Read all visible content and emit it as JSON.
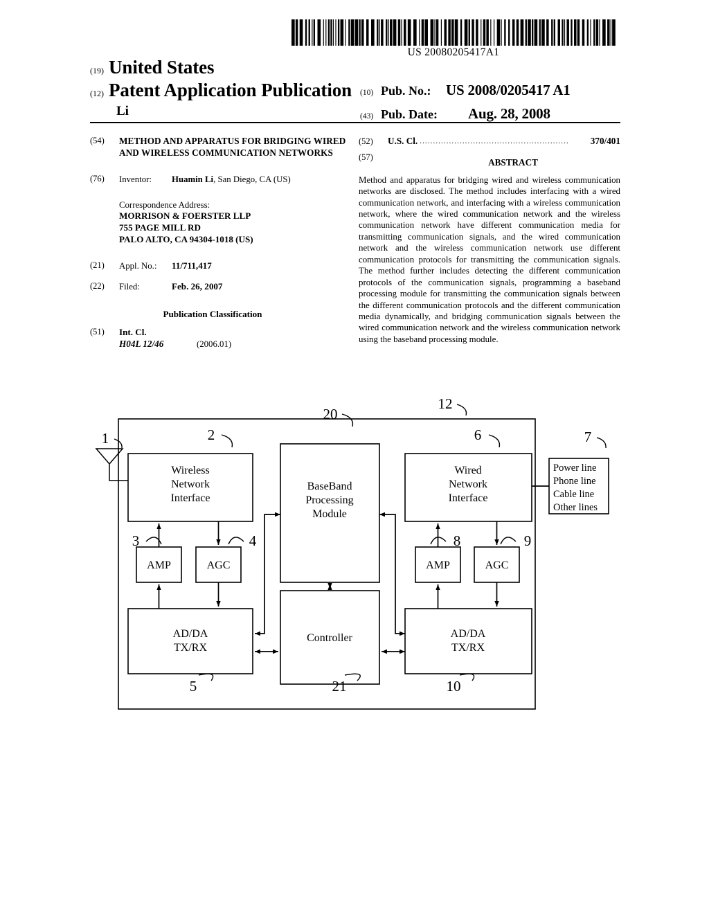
{
  "barcode": {
    "number": "US 20080205417A1"
  },
  "masthead": {
    "code_19": "(19)",
    "country": "United States",
    "code_12": "(12)",
    "doc_type": "Patent Application Publication",
    "author": "Li",
    "pub_no_code": "(10)",
    "pub_no_label": "Pub. No.:",
    "pub_no_value": "US 2008/0205417 A1",
    "pub_date_code": "(43)",
    "pub_date_label": "Pub. Date:",
    "pub_date_value": "Aug. 28, 2008"
  },
  "biblio": {
    "title_code": "(54)",
    "title": "METHOD AND APPARATUS FOR BRIDGING WIRED AND WIRELESS COMMUNICATION NETWORKS",
    "inventor_code": "(76)",
    "inventor_label": "Inventor:",
    "inventor_name": "Huamin Li",
    "inventor_rest": ", San Diego, CA (US)",
    "correspondence_label": "Correspondence Address:",
    "correspondence_lines": [
      "MORRISON & FOERSTER LLP",
      "755 PAGE MILL RD",
      "PALO ALTO, CA 94304-1018 (US)"
    ],
    "appl_no_code": "(21)",
    "appl_no_label": "Appl. No.:",
    "appl_no_value": "11/711,417",
    "filed_code": "(22)",
    "filed_label": "Filed:",
    "filed_value": "Feb. 26, 2007",
    "pub_class_heading": "Publication Classification",
    "int_cl_code": "(51)",
    "int_cl_label": "Int. Cl.",
    "int_cl_value": "H04L 12/46",
    "int_cl_version": "(2006.01)"
  },
  "right_column": {
    "us_cl_code": "(52)",
    "us_cl_label": "U.S. Cl.",
    "us_cl_dots": "........................................................",
    "us_cl_value": "370/401",
    "abstract_code": "(57)",
    "abstract_heading": "ABSTRACT",
    "abstract_text": "Method and apparatus for bridging wired and wireless communication networks are disclosed. The method includes interfacing with a wired communication network, and interfacing with a wireless communication network, where the wired communication network and the wireless communication network have different communication media for transmitting communication signals, and the wired communication network and the wireless communication network use different communication protocols for transmitting the communication signals. The method further includes detecting the different communication protocols of the communication signals, programming a baseband processing module for transmitting the communication signals between the different communication protocols and the different communication media dynamically, and bridging communication signals between the wired communication network and the wireless communication network using the baseband processing module."
  },
  "figure": {
    "blocks": {
      "wireless_network_interface": [
        "Wireless",
        "Network",
        "Interface"
      ],
      "baseband_processing_module": [
        "BaseBand",
        "Processing",
        "Module"
      ],
      "wired_network_interface": [
        "Wired",
        "Network",
        "Interface"
      ],
      "external_lines": [
        "Power line",
        "Phone line",
        "Cable line",
        "Other lines"
      ],
      "amp_left": "AMP",
      "agc_left": "AGC",
      "amp_right": "AMP",
      "agc_right": "AGC",
      "adda_left": [
        "AD/DA",
        "TX/RX"
      ],
      "adda_right": [
        "AD/DA",
        "TX/RX"
      ],
      "controller": "Controller"
    },
    "ref_numerals": {
      "antenna": "1",
      "wireless_interface": "2",
      "amp_left": "3",
      "agc_left": "4",
      "adda_left": "5",
      "wired_interface": "6",
      "external_lines": "7",
      "amp_right": "8",
      "agc_right": "9",
      "adda_right": "10",
      "device_frame": "12",
      "baseband_module": "20",
      "controller": "21"
    }
  }
}
